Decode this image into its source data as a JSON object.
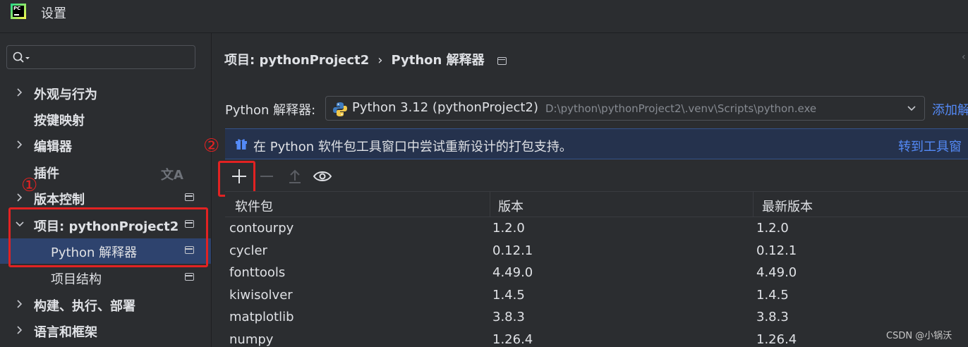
{
  "window": {
    "logo_text": "PC",
    "title": "设置"
  },
  "search": {
    "placeholder": "",
    "value": ""
  },
  "sidebar": {
    "items": [
      {
        "label": "外观与行为"
      },
      {
        "label": "按键映射"
      },
      {
        "label": "编辑器"
      },
      {
        "label": "插件"
      },
      {
        "label": "版本控制"
      },
      {
        "label": "项目: pythonProject2"
      },
      {
        "label": "Python 解释器"
      },
      {
        "label": "项目结构"
      },
      {
        "label": "构建、执行、部署"
      },
      {
        "label": "语言和框架"
      }
    ]
  },
  "annotations": {
    "one": "①",
    "two": "②"
  },
  "breadcrumb": {
    "project": "项目: pythonProject2",
    "sep": "›",
    "page": "Python 解释器"
  },
  "interpreter": {
    "label": "Python 解释器:",
    "name": "Python 3.12 (pythonProject2)",
    "path": "D:\\python\\pythonProject2\\.venv\\Scripts\\python.exe",
    "add_link": "添加解"
  },
  "banner": {
    "text": "在 Python 软件包工具窗口中尝试重新设计的打包支持。",
    "link": "转到工具窗"
  },
  "table": {
    "headers": [
      "软件包",
      "版本",
      "最新版本"
    ],
    "rows": [
      [
        "contourpy",
        "1.2.0",
        "1.2.0"
      ],
      [
        "cycler",
        "0.12.1",
        "0.12.1"
      ],
      [
        "fonttools",
        "4.49.0",
        "4.49.0"
      ],
      [
        "kiwisolver",
        "1.4.5",
        "1.4.5"
      ],
      [
        "matplotlib",
        "3.8.3",
        "3.8.3"
      ],
      [
        "numpy",
        "1.26.4",
        "1.26.4"
      ]
    ]
  },
  "watermark": "CSDN @小锅沃",
  "colors": {
    "background": "#2b2d30",
    "selection": "#2e436e",
    "link": "#548af7",
    "annotation": "#e22222",
    "banner": "#25324d"
  }
}
